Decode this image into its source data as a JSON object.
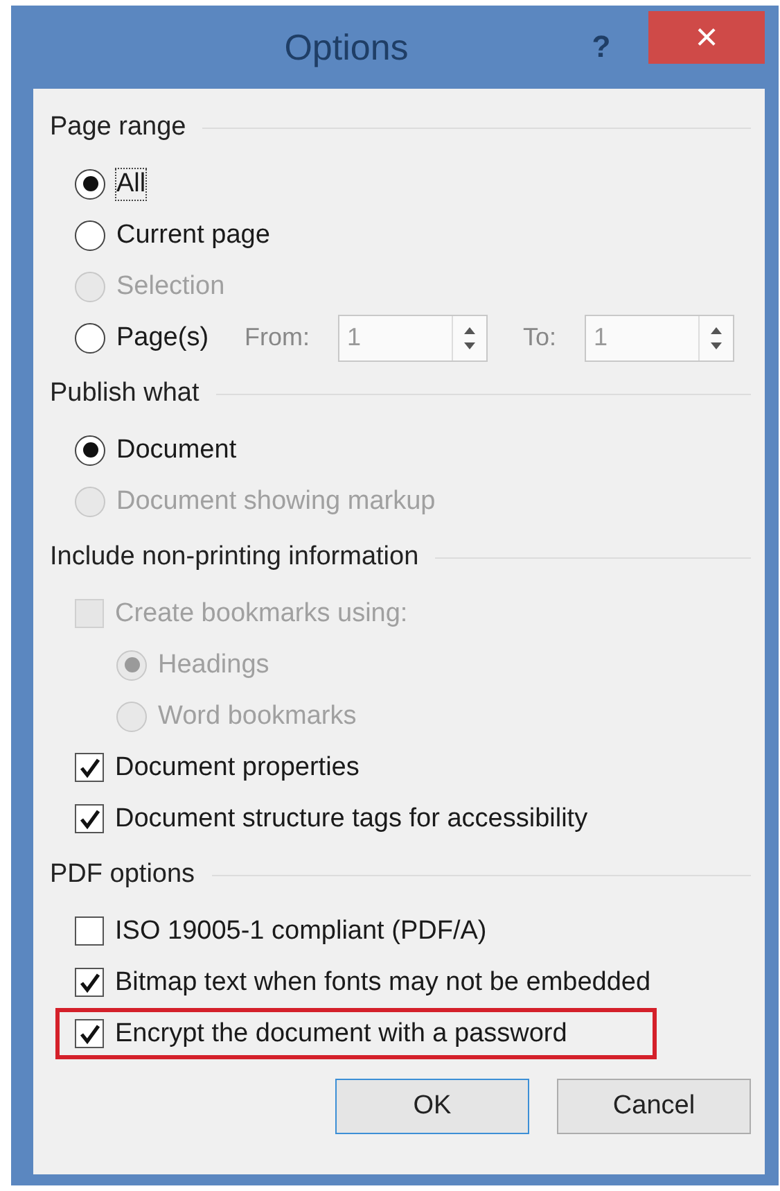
{
  "window": {
    "title": "Options",
    "help": "?",
    "close": "×"
  },
  "sections": [
    {
      "title": "Page range",
      "items": [
        {
          "kind": "radio",
          "label": "All",
          "selected": true,
          "disabled": false,
          "focused": true
        },
        {
          "kind": "radio",
          "label": "Current page",
          "selected": false,
          "disabled": false,
          "focused": false
        },
        {
          "kind": "radio",
          "label": "Selection",
          "selected": false,
          "disabled": true,
          "focused": false
        },
        {
          "kind": "pages",
          "label": "Page(s)",
          "selected": false,
          "disabled": false,
          "focused": false,
          "from_label": "From:",
          "from_value": "1",
          "to_label": "To:",
          "to_value": "1"
        }
      ]
    },
    {
      "title": "Publish what",
      "items": [
        {
          "kind": "radio",
          "label": "Document",
          "selected": true,
          "disabled": false,
          "focused": false
        },
        {
          "kind": "radio",
          "label": "Document showing markup",
          "selected": false,
          "disabled": true,
          "focused": false
        }
      ]
    },
    {
      "title": "Include non-printing information",
      "items": [
        {
          "kind": "checkbox",
          "label": "Create bookmarks using:",
          "checked": false,
          "disabled": true,
          "highlighted": false,
          "children": [
            {
              "kind": "radio",
              "label": "Headings",
              "selected": true,
              "disabled": true,
              "focused": false
            },
            {
              "kind": "radio",
              "label": "Word bookmarks",
              "selected": false,
              "disabled": true,
              "focused": false
            }
          ]
        },
        {
          "kind": "checkbox",
          "label": "Document properties",
          "checked": true,
          "disabled": false,
          "highlighted": false
        },
        {
          "kind": "checkbox",
          "label": "Document structure tags for accessibility",
          "checked": true,
          "disabled": false,
          "highlighted": false
        }
      ]
    },
    {
      "title": "PDF options",
      "items": [
        {
          "kind": "checkbox",
          "label": "ISO 19005-1 compliant (PDF/A)",
          "checked": false,
          "disabled": false,
          "highlighted": false
        },
        {
          "kind": "checkbox",
          "label": "Bitmap text when fonts may not be embedded",
          "checked": true,
          "disabled": false,
          "highlighted": false
        },
        {
          "kind": "checkbox",
          "label": "Encrypt the document with a password",
          "checked": true,
          "disabled": false,
          "highlighted": true
        }
      ]
    }
  ],
  "buttons": [
    {
      "label": "OK",
      "default": true
    },
    {
      "label": "Cancel",
      "default": false
    }
  ]
}
